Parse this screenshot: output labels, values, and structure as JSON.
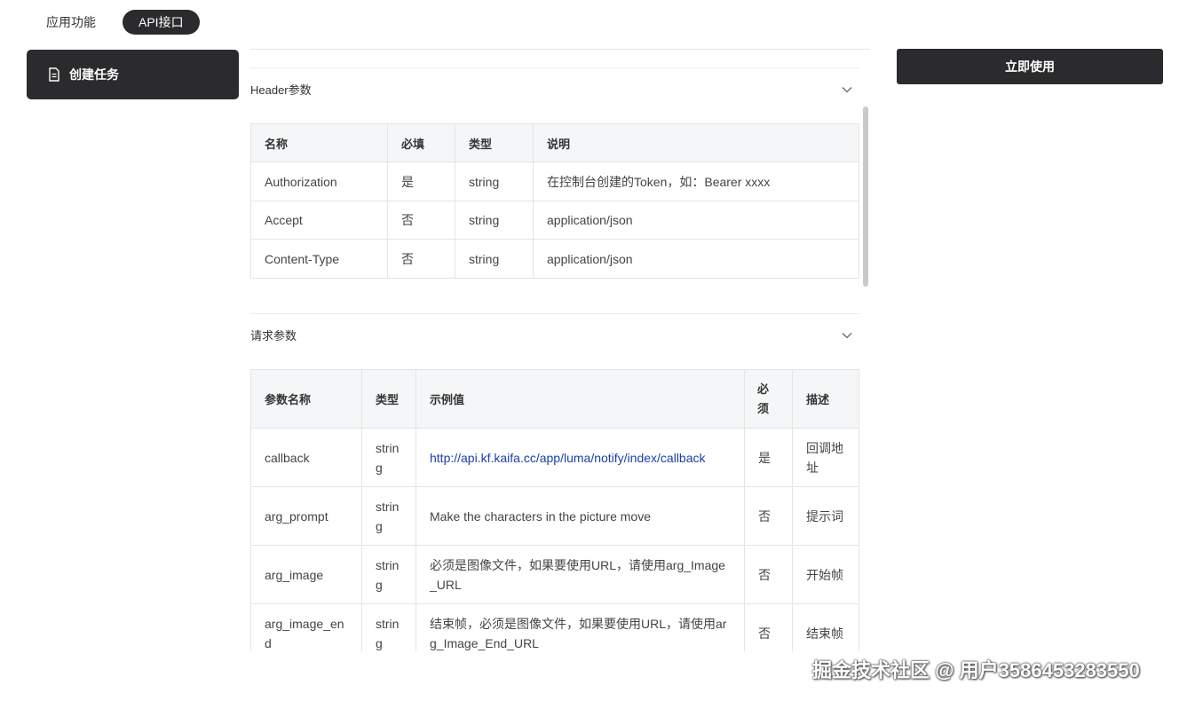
{
  "tabs": [
    {
      "label": "应用功能",
      "active": false
    },
    {
      "label": "API接口",
      "active": true
    }
  ],
  "sidebar": {
    "items": [
      {
        "label": "创建任务",
        "icon": "document-icon"
      }
    ]
  },
  "actions": {
    "use_now": "立即使用"
  },
  "header_section": {
    "title": "Header参数",
    "columns": [
      "名称",
      "必填",
      "类型",
      "说明"
    ],
    "rows": [
      [
        "Authorization",
        "是",
        "string",
        "在控制台创建的Token，如：Bearer xxxx"
      ],
      [
        "Accept",
        "否",
        "string",
        "application/json"
      ],
      [
        "Content-Type",
        "否",
        "string",
        "application/json"
      ]
    ]
  },
  "request_section": {
    "title": "请求参数",
    "columns": [
      "参数名称",
      "类型",
      "示例值",
      "必须",
      "描述"
    ],
    "rows": [
      [
        "callback",
        "string",
        "http://api.kf.kaifa.cc/app/luma/notify/index/callback",
        "是",
        "回调地址"
      ],
      [
        "arg_prompt",
        "string",
        "Make the characters in the picture move",
        "否",
        "提示词"
      ],
      [
        "arg_image",
        "string",
        "必须是图像文件，如果要使用URL，请使用arg_Image_URL",
        "否",
        "开始帧"
      ],
      [
        "arg_image_end",
        "string",
        "结束帧，必须是图像文件，如果要使用URL，请使用arg_Image_End_URL",
        "否",
        "结束帧"
      ]
    ]
  },
  "watermark": "掘金技术社区 @ 用户3586453283550",
  "colors": {
    "dark": "#2b2b2d",
    "link": "#1b3fa8",
    "header_bg": "#f5f6f7"
  }
}
